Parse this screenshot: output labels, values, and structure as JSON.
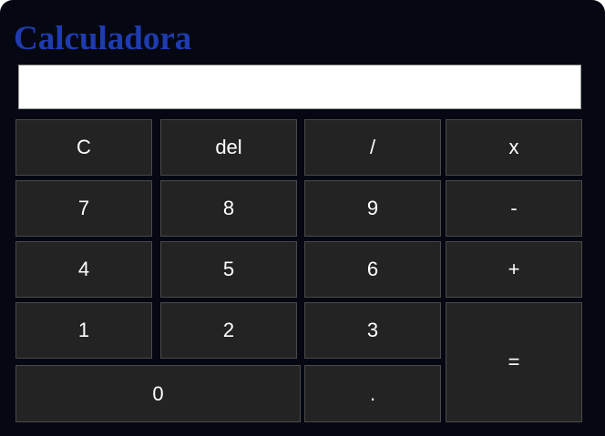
{
  "app": {
    "title": "Calculadora"
  },
  "display": {
    "value": ""
  },
  "keys": {
    "clear": "C",
    "delete": "del",
    "divide": "/",
    "multiply": "x",
    "seven": "7",
    "eight": "8",
    "nine": "9",
    "subtract": "-",
    "four": "4",
    "five": "5",
    "six": "6",
    "add": "+",
    "one": "1",
    "two": "2",
    "three": "3",
    "equals": "=",
    "zero": "0",
    "decimal": "."
  },
  "colors": {
    "background": "#050812",
    "title": "#1f3bb0",
    "key": "#232323",
    "key_text": "#ffffff",
    "display": "#ffffff"
  }
}
